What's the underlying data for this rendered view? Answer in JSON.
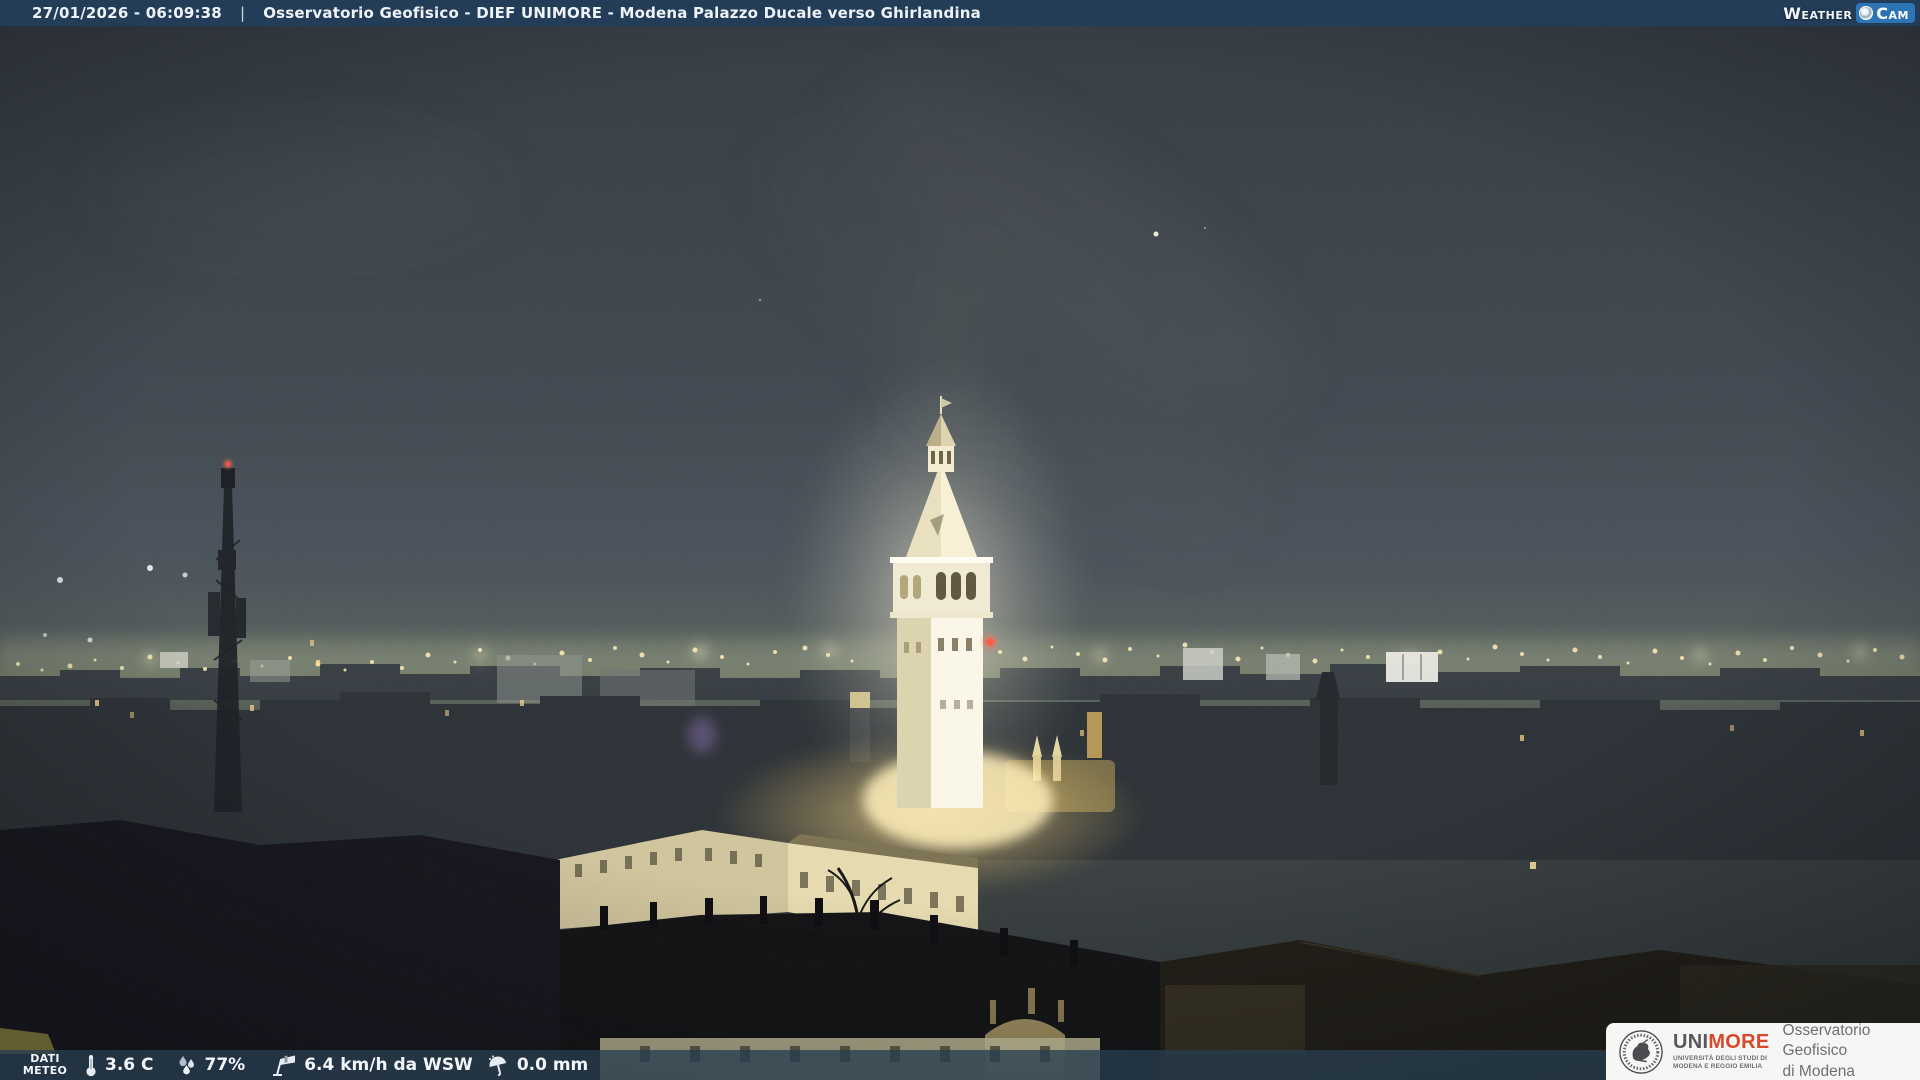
{
  "header": {
    "timestamp": "27/01/2026 - 06:09:38",
    "separator": "|",
    "title": "Osservatorio Geofisico - DIEF UNIMORE - Modena Palazzo Ducale verso Ghirlandina"
  },
  "watermark": {
    "weather": "Weather",
    "cam": "Cam",
    "lens_icon": "camera-lens-icon"
  },
  "footer": {
    "label_line1": "DATI",
    "label_line2": "METEO",
    "metrics": [
      {
        "icon": "thermometer-icon",
        "value": "3.6 C"
      },
      {
        "icon": "humidity-icon",
        "value": "77%"
      },
      {
        "icon": "windsock-icon",
        "value": "6.4 km/h da WSW"
      },
      {
        "icon": "umbrella-icon",
        "value": "0.0 mm"
      }
    ]
  },
  "credit": {
    "seal_icon": "unimore-seal-icon",
    "brand_uni": "UNI",
    "brand_more": "MORE",
    "subtitle_line1": "UNIVERSITÀ DEGLI STUDI DI",
    "subtitle_line2": "MODENA E REGGIO EMILIA",
    "org_line1": "Osservatorio Geofisico",
    "org_line2": "di Modena"
  },
  "colors": {
    "header-bg": "#233d59",
    "footer-bg": "rgba(40,62,80,0.78)",
    "watermark-blue": "#2d74b5",
    "unimore-red": "#d7492a"
  }
}
